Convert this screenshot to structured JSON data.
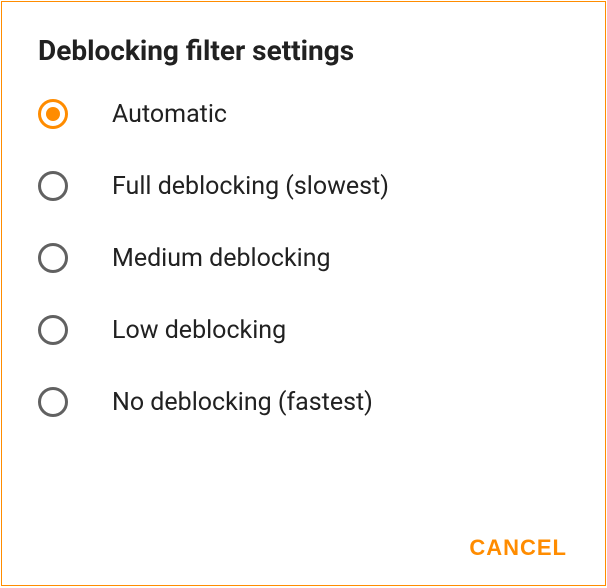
{
  "dialog": {
    "title": "Deblocking filter settings",
    "options": [
      {
        "label": "Automatic",
        "selected": true
      },
      {
        "label": "Full deblocking (slowest)",
        "selected": false
      },
      {
        "label": "Medium deblocking",
        "selected": false
      },
      {
        "label": "Low deblocking",
        "selected": false
      },
      {
        "label": "No deblocking (fastest)",
        "selected": false
      }
    ],
    "cancel_label": "CANCEL"
  },
  "colors": {
    "accent": "#ff8c00",
    "text": "#212121",
    "radio_unselected": "#616161"
  }
}
